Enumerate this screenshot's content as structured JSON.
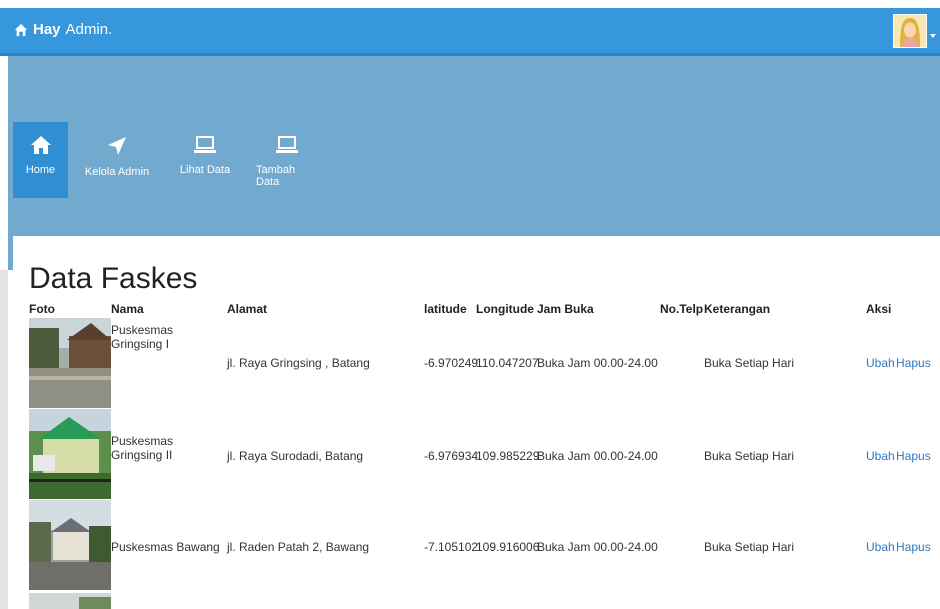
{
  "header": {
    "brand_greeting": "Hay",
    "brand_user": "Admin."
  },
  "nav": [
    {
      "label": "Home",
      "icon": "home-icon",
      "active": true
    },
    {
      "label": "Kelola Admin",
      "icon": "location-arrow-icon"
    },
    {
      "label": "Lihat Data",
      "icon": "laptop-icon"
    },
    {
      "label": "Tambah Data",
      "icon": "laptop-icon"
    }
  ],
  "page": {
    "title": "Data Faskes"
  },
  "table": {
    "columns": [
      "Foto",
      "Nama",
      "Alamat",
      "latitude",
      "Longitude",
      "Jam Buka",
      "No.Telp",
      "Keterangan",
      "Aksi"
    ],
    "rows": [
      {
        "nama": "Puskesmas Gringsing I",
        "alamat": "jl. Raya Gringsing , Batang",
        "latitude": "-6.970249",
        "longitude": "110.047207",
        "jam_buka": "Buka Jam 00.00-24.00",
        "no_telp": "",
        "keterangan": "Buka Setiap Hari",
        "ubah": "Ubah",
        "hapus": "Hapus"
      },
      {
        "nama": "Puskesmas Gringsing II",
        "alamat": "jl. Raya Surodadi, Batang",
        "latitude": "-6.976934",
        "longitude": "109.985229",
        "jam_buka": "Buka Jam 00.00-24.00",
        "no_telp": "",
        "keterangan": "Buka Setiap Hari",
        "ubah": "Ubah",
        "hapus": "Hapus"
      },
      {
        "nama": "Puskesmas Bawang",
        "alamat": "jl. Raden Patah 2, Bawang",
        "latitude": "-7.105102",
        "longitude": "109.916006",
        "jam_buka": "Buka Jam 00.00-24.00",
        "no_telp": "",
        "keterangan": "Buka Setiap Hari",
        "ubah": "Ubah",
        "hapus": "Hapus"
      }
    ]
  },
  "colors": {
    "topbar": "#3797dc",
    "hero": "#72a9cf",
    "active_nav": "#2f8fd2",
    "link": "#3079c0"
  }
}
